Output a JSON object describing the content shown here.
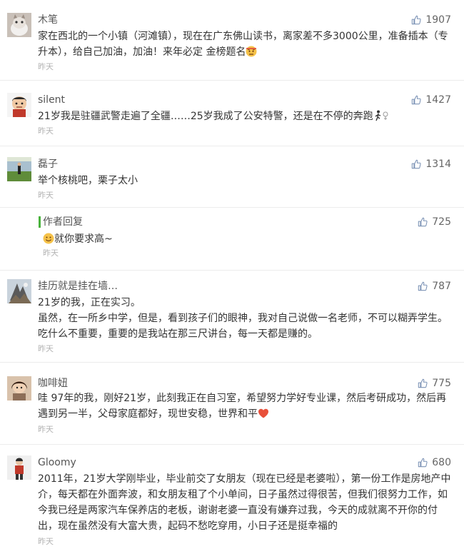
{
  "comments": [
    {
      "name": "木笔",
      "likes": "1907",
      "lines": [
        "家在西北的一个小镇（河滩镇），现在在广东佛山读书，离家差不多3000公里，准备插本（专升本），给自己加油，加油！来年必定 金榜题名"
      ],
      "emoji": "determined-face-emoji",
      "time": "昨天"
    },
    {
      "name": "silent",
      "likes": "1427",
      "lines": [
        "21岁我是驻疆武警走遍了全疆……25岁我成了公安特警，还是在不停的奔跑"
      ],
      "emoji": "running-woman-emoji",
      "time": "昨天"
    },
    {
      "name": "磊子",
      "likes": "1314",
      "lines": [
        "举个核桃吧，栗子太小"
      ],
      "time": "昨天"
    },
    {
      "name": "作者回复",
      "likes": "725",
      "lines": [
        "就你要求高~"
      ],
      "emoji": "smile-face-emoji",
      "time": "昨天",
      "is_author_reply": true
    },
    {
      "name": "挂历就是挂在墙…",
      "likes": "787",
      "lines": [
        "21岁的我，正在实习。",
        "虽然，在一所乡中学，但是，看到孩子们的眼神，我对自己说做一名老师，不可以糊弄学生。吃什么不重要，重要的是我站在那三尺讲台，每一天都是赚的。"
      ],
      "time": "昨天"
    },
    {
      "name": "咖啡妞",
      "likes": "775",
      "lines": [
        "哇 97年的我，刚好21岁，此刻我正在自习室，希望努力学好专业课，然后考研成功，然后再遇到另一半，父母家庭都好，现世安稳，世界和平"
      ],
      "emoji": "heart-emoji",
      "time": "昨天"
    },
    {
      "name": "Gloomy",
      "likes": "680",
      "lines": [
        "2011年，21岁大学刚毕业，毕业前交了女朋友（现在已经是老婆啦），第一份工作是房地产中介，每天都在外面奔波，和女朋友租了个小单间，日子虽然过得很苦，但我们很努力工作，如今我已经是两家汽车保养店的老板，谢谢老婆一直没有嫌弃过我，今天的成就离不开你的付出，现在虽然没有大富大贵，起码不愁吃穿用，小日子还是挺幸福的"
      ],
      "time": "昨天"
    }
  ],
  "colors": {
    "text": "#333333",
    "meta": "#b3b3b3",
    "name": "#555555",
    "author_bar": "#49b23c",
    "divider": "#ececec"
  },
  "icons": {
    "like": "thumbs-up-icon"
  }
}
